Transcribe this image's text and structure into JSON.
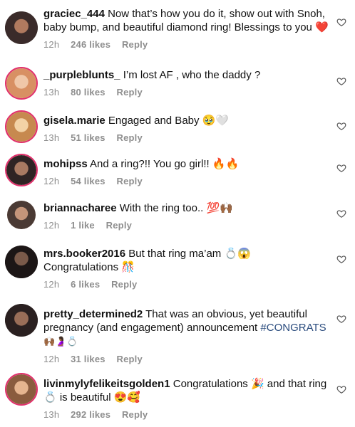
{
  "comments": [
    {
      "user": "graciec_444",
      "text": "Now that’s how you do it, show out with Snoh, baby bump, and beautiful diamond ring! Blessings to you ❤️",
      "time": "12h",
      "likes": "246 likes",
      "reply": "Reply"
    },
    {
      "user": "_purpleblunts_",
      "text": "I’m lost AF , who the daddy ?",
      "time": "13h",
      "likes": "80 likes",
      "reply": "Reply"
    },
    {
      "user": "gisela.marie",
      "text": "Engaged and Baby 🥹🤍",
      "time": "13h",
      "likes": "51 likes",
      "reply": "Reply"
    },
    {
      "user": "mohipss",
      "text": "And a ring?!! You go girl!! 🔥🔥",
      "time": "12h",
      "likes": "54 likes",
      "reply": "Reply"
    },
    {
      "user": "briannacharee",
      "text": "With the ring too.. 💯🙌🏾",
      "time": "12h",
      "likes": "1 like",
      "reply": "Reply"
    },
    {
      "user": "mrs.booker2016",
      "text": "But that ring ma’am 💍😱 Congratulations 🎊",
      "time": "12h",
      "likes": "6 likes",
      "reply": "Reply"
    },
    {
      "user": "pretty_determined2",
      "text": "That was an obvious, yet beautiful pregnancy (and engagement) announcement",
      "hashtag": "#CONGRATS",
      "emoji_tail": "🙌🏾🤰🏾💍",
      "time": "12h",
      "likes": "31 likes",
      "reply": "Reply"
    },
    {
      "user": "livinmylyfelikeitsgolden1",
      "text": "Congratulations 🎉 and that ring 💍 is beautiful 😍🥰",
      "time": "13h",
      "likes": "292 likes",
      "reply": "Reply"
    }
  ],
  "icons": {
    "heart": "heart-outline-icon",
    "avatar_ring_color": "#e1306c"
  }
}
